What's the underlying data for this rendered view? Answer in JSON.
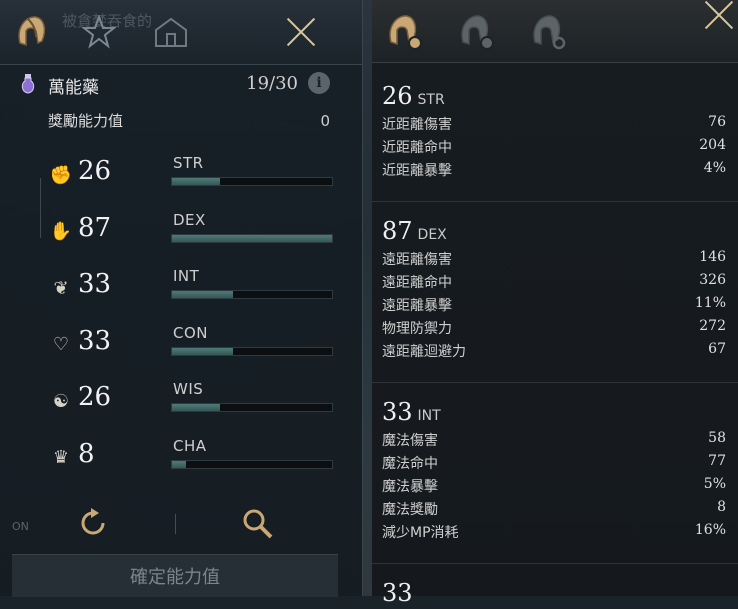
{
  "left": {
    "faded_title": "被貪婪吞食的",
    "potion": {
      "name": "萬能藥",
      "count": "19/30"
    },
    "bonus": {
      "label": "獎勵能力值",
      "value": "0"
    },
    "stats": [
      {
        "abbr": "STR",
        "value": "26",
        "fill": 0.3
      },
      {
        "abbr": "DEX",
        "value": "87",
        "fill": 1.0
      },
      {
        "abbr": "INT",
        "value": "33",
        "fill": 0.38
      },
      {
        "abbr": "CON",
        "value": "33",
        "fill": 0.38
      },
      {
        "abbr": "WIS",
        "value": "26",
        "fill": 0.3
      },
      {
        "abbr": "CHA",
        "value": "8",
        "fill": 0.09
      }
    ],
    "on_badge": "ON",
    "confirm_label": "確定能力值"
  },
  "right": {
    "sections": [
      {
        "num": "26",
        "abbr": "STR",
        "lines": [
          {
            "name": "近距離傷害",
            "value": "76"
          },
          {
            "name": "近距離命中",
            "value": "204"
          },
          {
            "name": "近距離暴擊",
            "value": "4%"
          }
        ]
      },
      {
        "num": "87",
        "abbr": "DEX",
        "lines": [
          {
            "name": "遠距離傷害",
            "value": "146"
          },
          {
            "name": "遠距離命中",
            "value": "326"
          },
          {
            "name": "遠距離暴擊",
            "value": "11%"
          },
          {
            "name": "物理防禦力",
            "value": "272"
          },
          {
            "name": "遠距離迴避力",
            "value": "67"
          }
        ]
      },
      {
        "num": "33",
        "abbr": "INT",
        "lines": [
          {
            "name": "魔法傷害",
            "value": "58"
          },
          {
            "name": "魔法命中",
            "value": "77"
          },
          {
            "name": "魔法暴擊",
            "value": "5%"
          },
          {
            "name": "魔法獎勵",
            "value": "8"
          },
          {
            "name": "減少MP消耗",
            "value": "16%"
          }
        ]
      },
      {
        "num": "33",
        "abbr": "",
        "lines": []
      }
    ]
  },
  "colors": {
    "accent": "#d9c79c",
    "bar_fill": "#4f7a78"
  }
}
